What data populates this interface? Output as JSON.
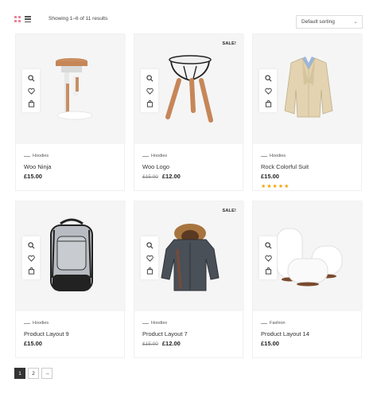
{
  "toolbar": {
    "result_count": "Showing 1–6 of 11 results",
    "sort_value": "Default sorting"
  },
  "products": [
    {
      "category": "Hoodies",
      "title": "Woo Ninja",
      "price": "£15.00",
      "old_price": "",
      "sale": "",
      "rating": 0
    },
    {
      "category": "Hoodies",
      "title": "Woo Logo",
      "price": "£12.00",
      "old_price": "£15.00",
      "sale": "SALE!",
      "rating": 0
    },
    {
      "category": "Hoodies",
      "title": "Rock Colorful Suit",
      "price": "£15.00",
      "old_price": "",
      "sale": "",
      "rating": 5
    },
    {
      "category": "Hoodies",
      "title": "Product Layout 9",
      "price": "£15.00",
      "old_price": "",
      "sale": "",
      "rating": 0
    },
    {
      "category": "Hoodies",
      "title": "Product Layout 7",
      "price": "£12.00",
      "old_price": "£15.00",
      "sale": "SALE!",
      "rating": 0
    },
    {
      "category": "Fashion",
      "title": "Product Layout 14",
      "price": "£15.00",
      "old_price": "",
      "sale": "",
      "rating": 0
    }
  ],
  "pagination": {
    "page1": "1",
    "page2": "2",
    "next": "→"
  },
  "colors": {
    "accent": "#e8869a",
    "star": "#f0a500",
    "card_bg": "#f5f5f5"
  },
  "icons": {
    "grid_view": "grid-view-icon",
    "list_view": "list-view-icon",
    "quick_view": "search-icon",
    "wishlist": "heart-icon",
    "add_to_cart": "bag-icon"
  }
}
